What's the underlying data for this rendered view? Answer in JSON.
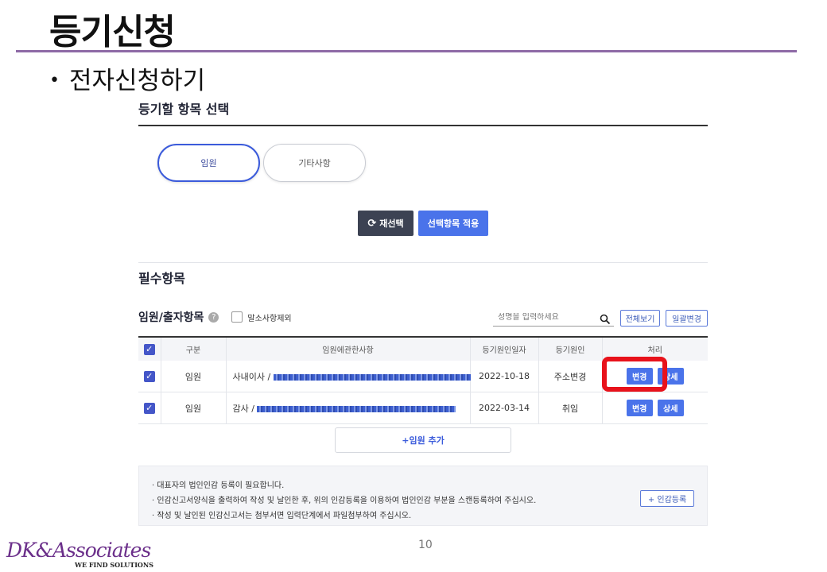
{
  "slide": {
    "title": "등기신청",
    "bullet": "전자신청하기",
    "page_number": "10"
  },
  "logo": {
    "name": "DK&Associates",
    "tagline": "WE FIND SOLUTIONS"
  },
  "section_select": {
    "title": "등기할 항목 선택",
    "options": [
      "임원",
      "기타사항"
    ],
    "selected": "임원",
    "reselect_label": "재선택",
    "apply_label": "선택항목 적용"
  },
  "required": {
    "title": "필수항목",
    "subtitle": "임원/출자항목",
    "help": "?",
    "exclude_label": "말소사항제외",
    "search_placeholder": "성명을 입력하세요",
    "view_all_label": "전체보기",
    "bulk_change_label": "일괄변경"
  },
  "table": {
    "columns": [
      "구분",
      "임원에관한사항",
      "등기원인일자",
      "등기원인",
      "처리"
    ],
    "rows": [
      {
        "type": "임원",
        "detail_prefix": "사내이사 /",
        "date": "2022-10-18",
        "cause": "주소변경",
        "actions": [
          "변경",
          "상세"
        ]
      },
      {
        "type": "임원",
        "detail_prefix": "감사 /",
        "date": "2022-03-14",
        "cause": "취임",
        "actions": [
          "변경",
          "상세"
        ]
      }
    ],
    "add_label": "+임원 추가"
  },
  "notice": {
    "lines": [
      "· 대표자의 법인인감 등록이 필요합니다.",
      "· 인감신고서양식을 출력하여 작성 및 날인한 후, 위의 인감등록을 이용하여 법인인감 부분을 스캔등록하여 주십시오.",
      "· 작성 및 날인된 인감신고서는 첨부서면 입력단계에서 파일첨부하여 주십시오."
    ],
    "seal_button": "+ 인감등록"
  },
  "colors": {
    "accent": "#4a73ea",
    "highlight": "#e8121b",
    "rule": "#8e6aa6"
  }
}
